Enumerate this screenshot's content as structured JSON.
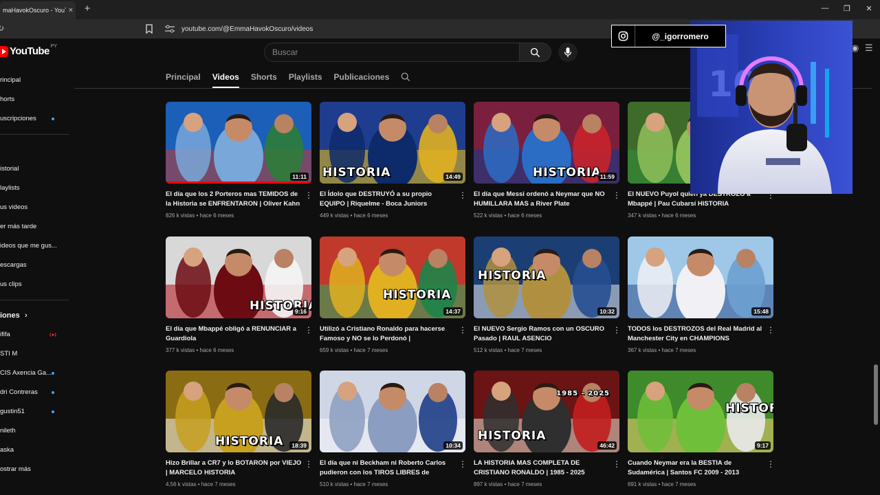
{
  "browser": {
    "tab_title": "maHavokOscuro - YouTube",
    "new_tab": "+",
    "tab_close": "×",
    "url": "youtube.com/@EmmaHavokOscuro/videos",
    "min": "—",
    "restore": "❐",
    "close": "✕"
  },
  "youtube": {
    "logo_text": "YouTube",
    "country": "PY",
    "search_placeholder": "Buscar"
  },
  "sidebar": {
    "items": [
      {
        "label": "rincipal",
        "top": 0
      },
      {
        "label": "horts",
        "top": 0
      },
      {
        "label": "uscripciones",
        "top": 0,
        "dot": true
      }
    ],
    "you_items": [
      {
        "label": "istorial"
      },
      {
        "label": "laylists"
      },
      {
        "label": "us videos"
      },
      {
        "label": "er más tarde"
      },
      {
        "label": "ideos que me gus..."
      },
      {
        "label": "escargas"
      },
      {
        "label": "us clips"
      }
    ],
    "subs_title": "iones",
    "subs": [
      {
        "label": "ififa",
        "live": true
      },
      {
        "label": "STI M"
      },
      {
        "label": "CIS Axencia Ga...",
        "dot": true
      },
      {
        "label": "dri Contreras",
        "dot": true
      },
      {
        "label": "gustin51",
        "dot": true
      },
      {
        "label": "nileth"
      },
      {
        "label": "aska"
      },
      {
        "label": "ostrar más"
      }
    ]
  },
  "channel_tabs": [
    "Principal",
    "Videos",
    "Shorts",
    "Playlists",
    "Publicaciones"
  ],
  "active_tab": "Videos",
  "videos": [
    {
      "title": "El día que los 2 Porteros mas TEMIDOS de la Historia se ENFRENTARON | Oliver Kahn vs...",
      "views": "826 k vistas",
      "age": "hace 6 meses",
      "duration": "11:11",
      "watched": true,
      "hist": ""
    },
    {
      "title": "El Ídolo que DESTRUYÓ a su propio EQUIPO | Riquelme - Boca Juniors",
      "views": "449 k vistas",
      "age": "hace 6 meses",
      "duration": "14:49",
      "hist": "HISTORIA"
    },
    {
      "title": "El día que Messi ordenó a Neymar que NO HUMILLARA MAS a River Plate",
      "views": "522 k vistas",
      "age": "hace 6 meses",
      "duration": "11:59",
      "hist": "HISTORIA"
    },
    {
      "title": "El NUEVO Puyol quien ya DESTROZÓ a Mbappé | Pau Cubarsí HISTORIA",
      "views": "347 k vistas",
      "age": "hace 6 meses",
      "duration": "",
      "hist": ""
    },
    {
      "title": "El día que Mbappé obligó a RENUNCIAR a Guardiola",
      "views": "377 k vistas",
      "age": "hace 6 meses",
      "duration": "9:16",
      "hist": "HISTORIA"
    },
    {
      "title": "Utilizó a Cristiano Ronaldo para hacerse Famoso y NO se lo Perdonó | IShowSpeed...",
      "views": "659 k vistas",
      "age": "hace 7 meses",
      "duration": "14:37",
      "hist": "HISTORIA"
    },
    {
      "title": "El NUEVO Sergio Ramos con un OSCURO Pasado | RAUL ASENCIO",
      "views": "512 k vistas",
      "age": "hace 7 meses",
      "duration": "10:32",
      "hist": "HISTORIA"
    },
    {
      "title": "TODOS los DESTROZOS del Real Madrid al Manchester City en CHAMPIONS",
      "views": "367 k vistas",
      "age": "hace 7 meses",
      "duration": "15:48",
      "hist": ""
    },
    {
      "title": "Hizo Brillar a CR7 y lo BOTARON por VIEJO | MARCELO HISTORIA",
      "views": "4,56 k vistas",
      "age": "hace 7 meses",
      "duration": "18:39",
      "hist": "HISTORIA"
    },
    {
      "title": "El día que ni Beckham ni Roberto Carlos pudieron con los TIROS LIBRES de JUNINHO",
      "views": "510 k vistas",
      "age": "hace 7 meses",
      "duration": "10:34",
      "hist": ""
    },
    {
      "title": "LA HISTORIA MAS COMPLETA DE CRISTIANO RONALDO | 1985 - 2025",
      "views": "897 k vistas",
      "age": "hace 7 meses",
      "duration": "46:42",
      "hist": "HISTORIA",
      "sub": "1985 - 2025"
    },
    {
      "title": "Cuando Neymar era la BESTIA de Sudamérica | Santos FC 2009 - 2013",
      "views": "691 k vistas",
      "age": "hace 7 meses",
      "duration": "9:17",
      "hist": "HISTORIA"
    }
  ],
  "overlay": {
    "instagram_handle": "@_igorromero"
  }
}
